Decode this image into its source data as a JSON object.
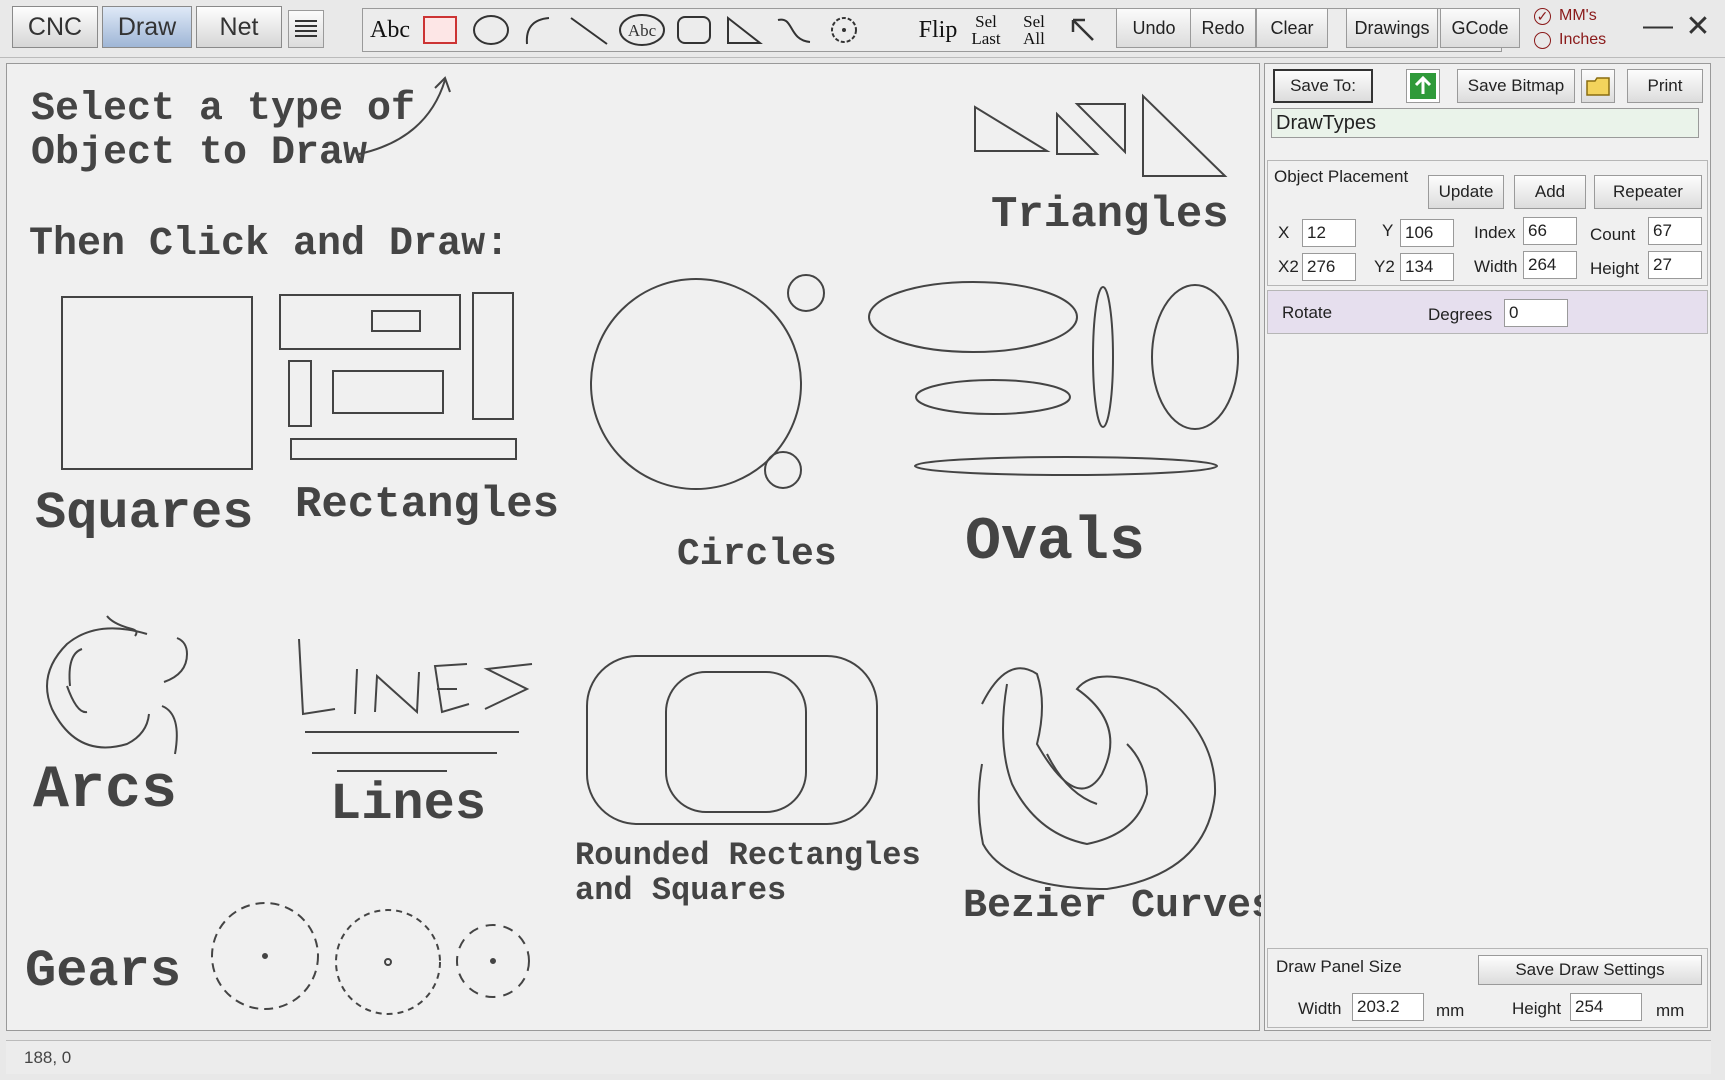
{
  "tabs": [
    {
      "label": "CNC",
      "active": false
    },
    {
      "label": "Draw",
      "active": true
    },
    {
      "label": "Net",
      "active": false
    }
  ],
  "tools": {
    "text_label": "Abc",
    "textcircle_label": "Abc",
    "flip_label": "Flip",
    "sel_last_top": "Sel",
    "sel_last_bottom": "Last",
    "sel_all_top": "Sel",
    "sel_all_bottom": "All"
  },
  "actions": {
    "undo": "Undo",
    "redo": "Redo",
    "clear": "Clear",
    "drawings": "Drawings",
    "gcode": "GCode"
  },
  "units": {
    "mm": "MM's",
    "inches": "Inches",
    "selected": "mm"
  },
  "canvas": {
    "instruction_line1": "Select a type of",
    "instruction_line2": "Object to Draw",
    "instruction_line3": "Then Click and Draw:",
    "labels": {
      "triangles": "Triangles",
      "squares": "Squares",
      "rectangles": "Rectangles",
      "circles": "Circles",
      "ovals": "Ovals",
      "arcs": "Arcs",
      "lines": "Lines",
      "rounded1": "Rounded Rectangles",
      "rounded2": "and Squares",
      "bezier": "Bezier Curves",
      "gears": "Gears"
    }
  },
  "panel": {
    "save_to": "Save To:",
    "save_bitmap": "Save Bitmap",
    "print": "Print",
    "filename": "DrawTypes",
    "placement_title": "Object Placement",
    "update": "Update",
    "add": "Add",
    "repeater": "Repeater",
    "fields": {
      "x_label": "X",
      "x": "12",
      "y_label": "Y",
      "y": "106",
      "index_label": "Index",
      "index": "66",
      "count_label": "Count",
      "count": "67",
      "x2_label": "X2",
      "x2": "276",
      "y2_label": "Y2",
      "y2": "134",
      "width_label": "Width",
      "width": "264",
      "height_label": "Height",
      "height": "27"
    },
    "rotate_label": "Rotate",
    "degrees_label": "Degrees",
    "degrees": "0",
    "draw_panel_title": "Draw Panel Size",
    "save_draw_settings": "Save Draw Settings",
    "dp_width_label": "Width",
    "dp_width": "203.2",
    "dp_width_unit": "mm",
    "dp_height_label": "Height",
    "dp_height": "254",
    "dp_height_unit": "mm"
  },
  "status": {
    "coords": "188, 0"
  },
  "colors": {
    "accent": "#a9bfdf",
    "rotate_bg": "#e6dfee",
    "upload_green": "#2f9a3a",
    "unit_red": "#8a1a1a"
  }
}
